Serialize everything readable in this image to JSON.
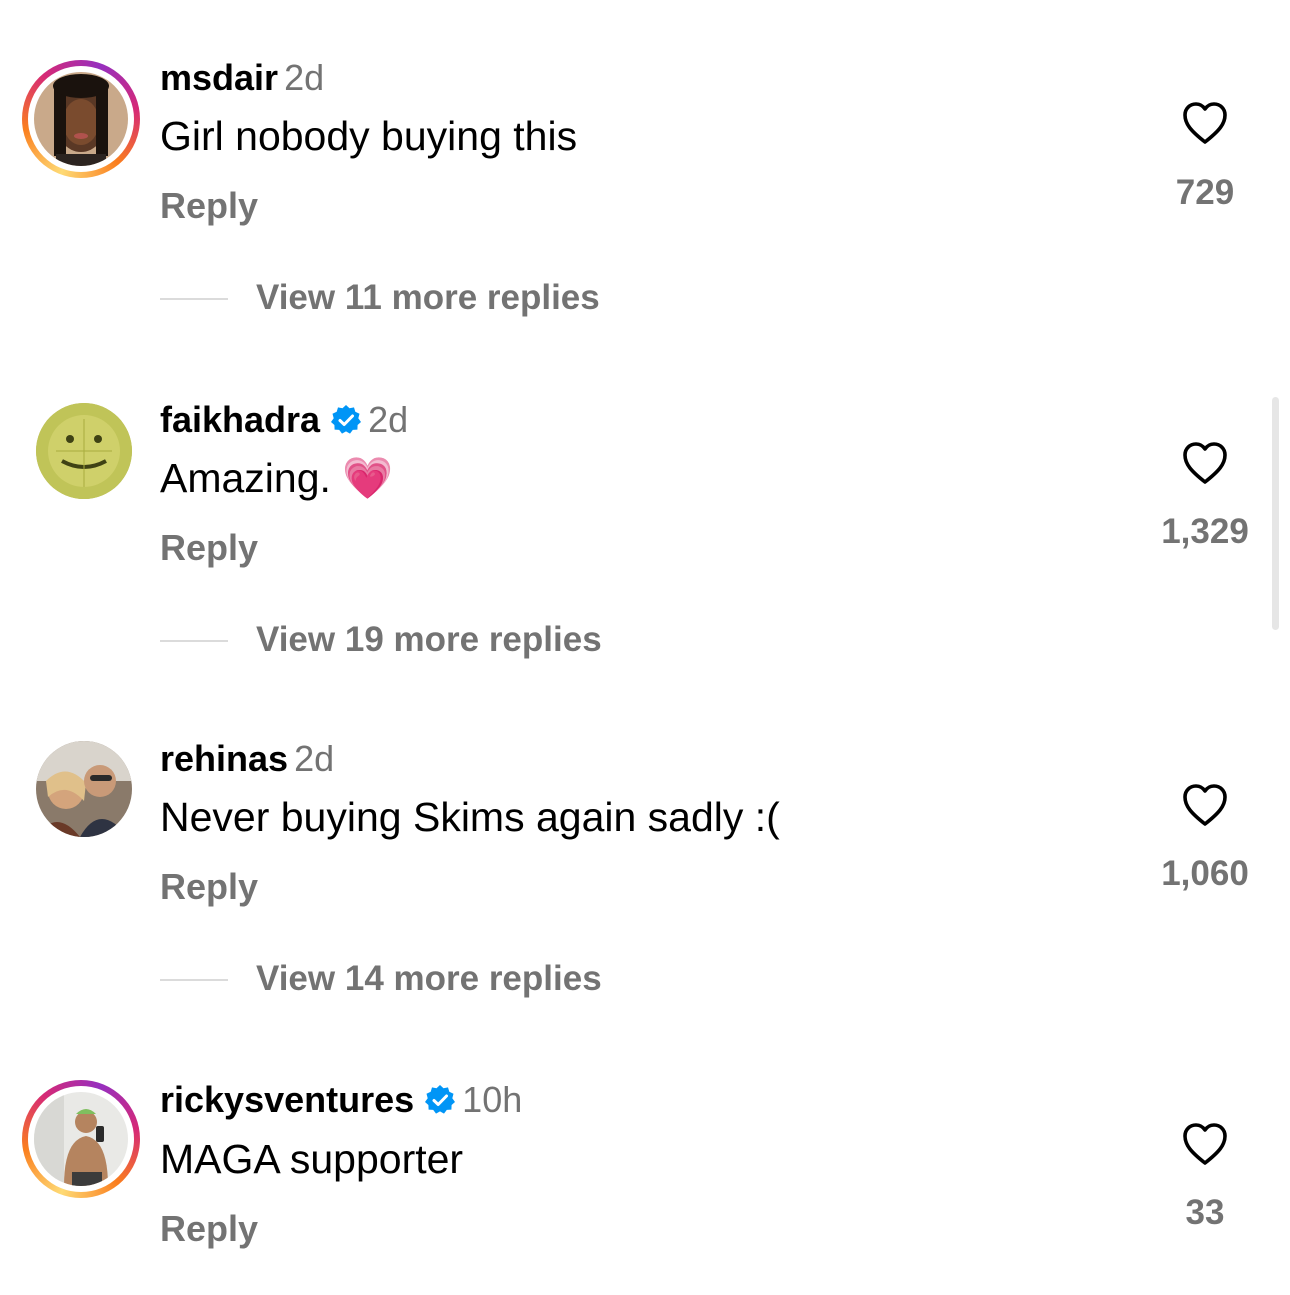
{
  "comments": [
    {
      "username": "msdair",
      "verified": false,
      "time": "2d",
      "text": "Girl nobody buying this",
      "reply_label": "Reply",
      "likes": "729",
      "view_replies": "View 11 more replies",
      "story_ring": true
    },
    {
      "username": "faikhadra",
      "verified": true,
      "time": "2d",
      "text": "Amazing. 💗",
      "reply_label": "Reply",
      "likes": "1,329",
      "view_replies": "View 19 more replies",
      "story_ring": false
    },
    {
      "username": "rehinas",
      "verified": false,
      "time": "2d",
      "text": "Never buying Skims again sadly :(",
      "reply_label": "Reply",
      "likes": "1,060",
      "view_replies": "View 14 more replies",
      "story_ring": false
    },
    {
      "username": "rickysventures",
      "verified": true,
      "time": "10h",
      "text": "MAGA supporter",
      "reply_label": "Reply",
      "likes": "33",
      "story_ring": true
    }
  ],
  "icons": {
    "like": "heart-outline-icon",
    "verified": "verified-badge-icon"
  },
  "colors": {
    "secondary_text": "#737373",
    "verified_blue": "#0095f6",
    "divider": "#dbdbdb"
  }
}
